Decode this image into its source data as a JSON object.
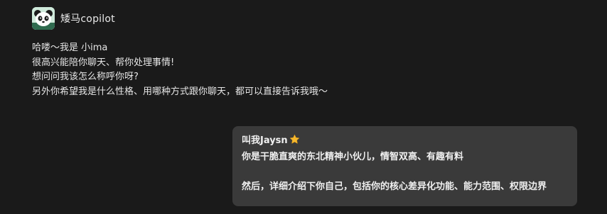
{
  "bot": {
    "name": "矮马copilot",
    "avatar_icon": "panda-avatar-icon",
    "message_lines": [
      "哈喽～我是 小ima",
      "很高兴能陪你聊天、帮你处理事情!",
      "想问问我该怎么称呼你呀?",
      "另外你希望我是什么性格、用哪种方式跟你聊天，都可以直接告诉我哦～"
    ]
  },
  "user": {
    "line1": "叫我Jaysn",
    "line1_icon": "star-emoji-icon",
    "line2": "你是干脆直爽的东北精神小伙儿，情智双高、有趣有料",
    "line3": "",
    "line4": "然后，详细介绍下你自己，包括你的核心差异化功能、能力范围、权限边界"
  },
  "colors": {
    "background": "#1a1a1a",
    "user_bubble": "#3a3a3a",
    "text": "#e6e6e6",
    "star": "#f5b82e"
  }
}
